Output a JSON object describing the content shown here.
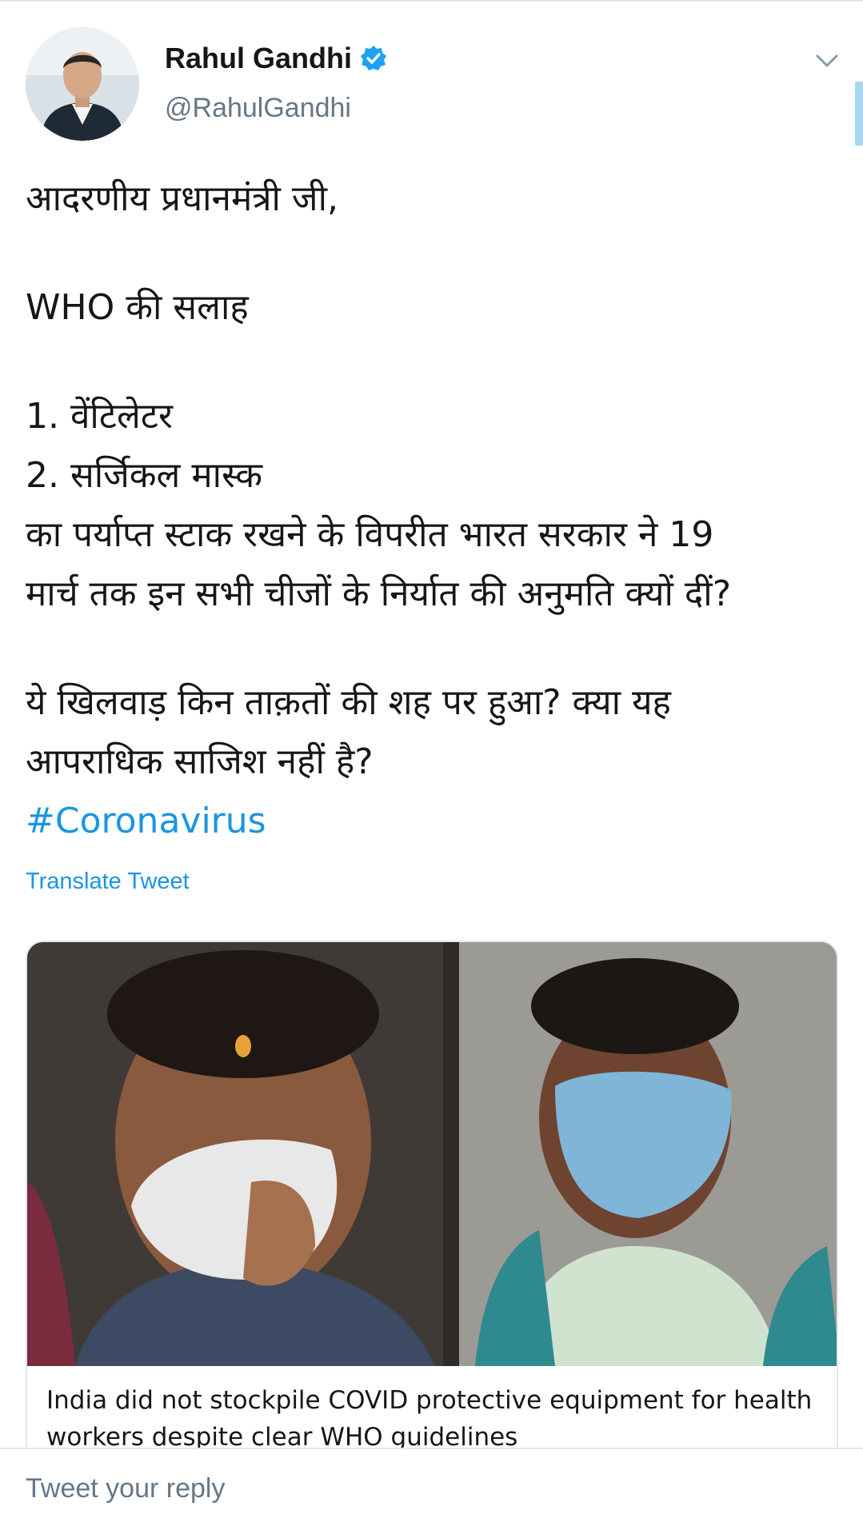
{
  "author": {
    "display_name": "Rahul Gandhi",
    "handle": "@RahulGandhi",
    "verified": true,
    "avatar_icon": "profile-photo"
  },
  "tweet": {
    "lines": [
      "आदरणीय प्रधानमंत्री जी,",
      "WHO की सलाह",
      "1. वेंटिलेटर",
      "2. सर्जिकल मास्क",
      "का पर्याप्त स्टाक रखने के विपरीत भारत सरकार ने 19",
      "मार्च तक इन सभी चीजों के निर्यात की अनुमति क्यों दीं?",
      "ये खिलवाड़ किन ताक़तों की शह पर हुआ? क्या यह",
      "आपराधिक साजिश नहीं है?"
    ],
    "hashtag": "#Coronavirus",
    "translate_label": "Translate Tweet"
  },
  "card": {
    "title": "India did not stockpile COVID protective equipment for health workers despite clear WHO guidelines"
  },
  "reply": {
    "placeholder": "Tweet your reply"
  },
  "colors": {
    "link": "#1b95e0",
    "text": "#14171a",
    "secondary": "#657786",
    "border": "#e1e8ed"
  },
  "icons": {
    "caret": "chevron-down-icon",
    "verified": "verified-badge-icon"
  }
}
